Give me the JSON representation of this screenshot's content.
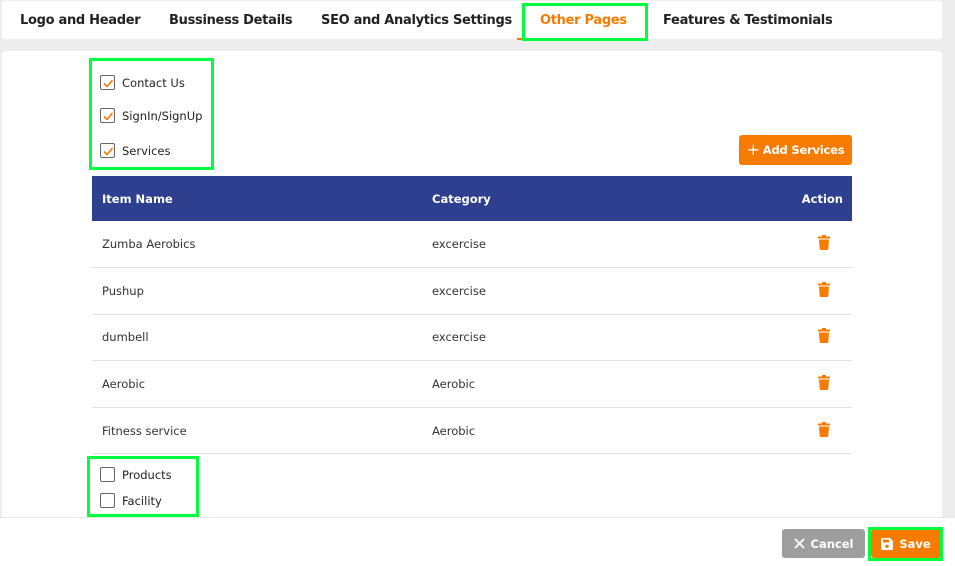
{
  "tabs": [
    {
      "label": "Logo and Header",
      "active": false
    },
    {
      "label": "Bussiness Details",
      "active": false
    },
    {
      "label": "SEO and Analytics Settings",
      "active": false
    },
    {
      "label": "Other Pages",
      "active": true
    },
    {
      "label": "Features & Testimonials",
      "active": false
    }
  ],
  "pages_top": [
    {
      "label": "Contact Us",
      "checked": true
    },
    {
      "label": "SignIn/SignUp",
      "checked": true
    },
    {
      "label": "Services",
      "checked": true
    }
  ],
  "add_services_label": "Add Services",
  "table": {
    "headers": {
      "name": "Item Name",
      "category": "Category",
      "action": "Action"
    },
    "rows": [
      {
        "name": "Zumba Aerobics",
        "category": "excercise"
      },
      {
        "name": "Pushup",
        "category": "excercise"
      },
      {
        "name": "dumbell",
        "category": "excercise"
      },
      {
        "name": "Aerobic",
        "category": "Aerobic"
      },
      {
        "name": "Fitness service",
        "category": "Aerobic"
      }
    ]
  },
  "pages_bottom": [
    {
      "label": "Products",
      "checked": false
    },
    {
      "label": "Facility",
      "checked": false
    }
  ],
  "footer": {
    "cancel_label": "Cancel",
    "save_label": "Save"
  },
  "colors": {
    "accent": "#f57c00",
    "header": "#2e3f8f",
    "highlight": "#00ff3c",
    "cancel": "#9e9e9e"
  }
}
